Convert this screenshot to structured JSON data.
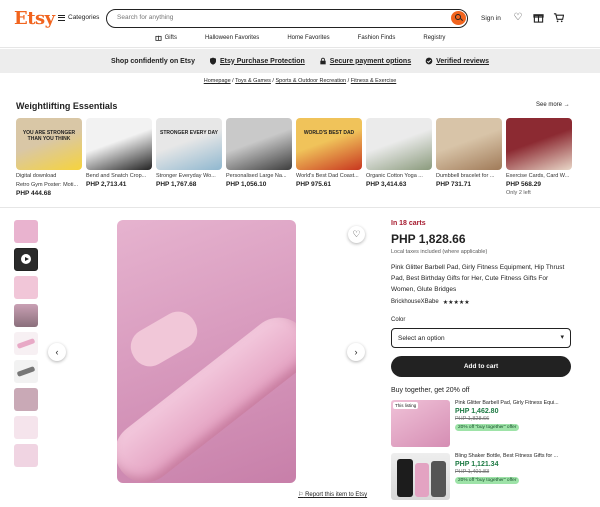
{
  "header": {
    "logo": "Etsy",
    "categories_label": "Categories",
    "search_placeholder": "Search for anything",
    "signin_label": "Sign in"
  },
  "subnav": [
    "Gifts",
    "Halloween Favorites",
    "Home Favorites",
    "Fashion Finds",
    "Registry"
  ],
  "shopbar": {
    "lead": "Shop confidently on Etsy",
    "items": [
      "Etsy Purchase Protection",
      "Secure payment options",
      "Verified reviews"
    ]
  },
  "breadcrumb": [
    "Homepage",
    "Toys & Games",
    "Sports & Outdoor Recreation",
    "Fitness & Exercise"
  ],
  "section": {
    "title": "Weightlifting Essentials",
    "see_more": "See more"
  },
  "carousel": [
    {
      "badge": "Digital download",
      "name": "Retro Gym Poster: Moti...",
      "price": "PHP 444.68",
      "extra": "",
      "art_text": "YOU ARE STRONGER THAN YOU THINK",
      "colors": [
        "#d9c7a6",
        "#f6d33c"
      ]
    },
    {
      "badge": "",
      "name": "Bend and Snatch Crop...",
      "price": "PHP 2,713.41",
      "extra": "",
      "art_text": "",
      "colors": [
        "#f2f2f2",
        "#222222"
      ]
    },
    {
      "badge": "",
      "name": "Stronger Everyday Wo...",
      "price": "PHP 1,767.68",
      "extra": "",
      "art_text": "STRONGER EVERY DAY",
      "colors": [
        "#e7e7e7",
        "#8fb7cf"
      ]
    },
    {
      "badge": "",
      "name": "Personalised Large Na...",
      "price": "PHP 1,056.10",
      "extra": "",
      "art_text": "",
      "colors": [
        "#c9c9c9",
        "#3d3d3d"
      ]
    },
    {
      "badge": "",
      "name": "World's Best Dad Coast...",
      "price": "PHP 975.61",
      "extra": "",
      "art_text": "WORLD'S BEST DAD",
      "colors": [
        "#f0c35a",
        "#c8361f"
      ]
    },
    {
      "badge": "",
      "name": "Organic Cotton Yoga ...",
      "price": "PHP 3,414.63",
      "extra": "",
      "art_text": "",
      "colors": [
        "#ebebeb",
        "#8a9a7c"
      ]
    },
    {
      "badge": "",
      "name": "Dumbbell bracelet for ...",
      "price": "PHP 731.71",
      "extra": "",
      "art_text": "",
      "colors": [
        "#d8c4a8",
        "#a07a58"
      ]
    },
    {
      "badge": "",
      "name": "Exercise Cards, Card W...",
      "price": "PHP 568.29",
      "extra": "Only 2 left",
      "art_text": "",
      "colors": [
        "#8c2a32",
        "#e9d7c8"
      ]
    }
  ],
  "product": {
    "carts": "In 18 carts",
    "price": "PHP 1,828.66",
    "tax_note": "Local taxes included (where applicable)",
    "title": "Pink Glitter Barbell Pad, Girly Fitness Equipment, Hip Thrust Pad, Best Birthday Gifts for Her, Cute Fitness Gifts For Women, Glute Bridges",
    "seller": "BrickhouseXBabe",
    "stars": "★★★★★",
    "color_label": "Color",
    "select_placeholder": "Select an option",
    "add_to_cart": "Add to cart",
    "report": "Report this item to Etsy"
  },
  "bundle": {
    "title": "Buy together, get 20% off",
    "items": [
      {
        "tag": "This listing",
        "name": "Pink Glitter Barbell Pad, Girly Fitness Equi...",
        "price": "PHP 1,462.80",
        "old_price": "PHP 1,828.66",
        "offer": "20% off \"buy together\" offer"
      },
      {
        "tag": "",
        "name": "Bling Shaker Bottle, Best Fitness Gifts for ...",
        "price": "PHP 1,121.34",
        "old_price": "PHP 1,401.83",
        "offer": "20% off \"buy together\" offer"
      }
    ]
  },
  "colors": {
    "brand": "#f1641e",
    "carts_red": "#a61a2e",
    "sale_green": "#1e7a44"
  }
}
